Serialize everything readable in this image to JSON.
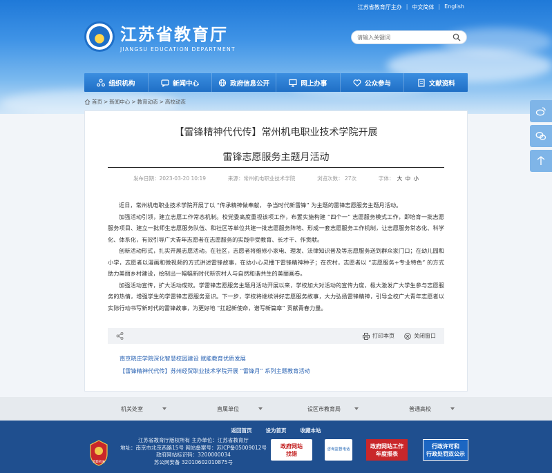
{
  "top_links": [
    "江苏省教育厅主办",
    "中文简体",
    "English"
  ],
  "logo": {
    "cn": "江苏省教育厅",
    "en": "JIANGSU EDUCATION DEPARTMENT"
  },
  "search": {
    "placeholder": "请输入关键词"
  },
  "nav": [
    {
      "label": "组织机构",
      "icon": "org-icon"
    },
    {
      "label": "新闻中心",
      "icon": "chat-icon"
    },
    {
      "label": "政府信息公开",
      "icon": "globe-icon"
    },
    {
      "label": "网上办事",
      "icon": "monitor-icon"
    },
    {
      "label": "公众参与",
      "icon": "heart-icon"
    },
    {
      "label": "文献资料",
      "icon": "book-icon"
    }
  ],
  "breadcrumb": [
    "首页",
    "新闻中心",
    "教育动态",
    "高校动态"
  ],
  "article": {
    "title_line1": "【雷锋精神代代传】常州机电职业技术学院开展",
    "title_line2": "雷锋志愿服务主题月活动",
    "meta": {
      "date": "发布日期：2023-03-20 10:19",
      "source": "来源：常州机电职业技术学院",
      "views": "浏览次数：  27次",
      "font_label": "字体：",
      "sizes": [
        "大",
        "中",
        "小"
      ]
    },
    "paragraphs": [
      "近日，常州机电职业技术学院开展了以 “传承精神做奉献， 争当时代新雷锋” 为主题的雷锋志愿服务主题月活动。",
      "加强活动引领，建立志愿工作常态机制。校党委高度重视该项工作，布置实施构建 “四个一” 志愿服务模式工作，即培育一批志愿服务项目、建立一批师生志愿服务队伍、和社区等单位共建一批志愿服务阵地、形成一套志愿服务工作机制，让志愿服务常态化、科学化、体系化，有效引导广大青年志愿者在志愿服务的实践中受教育、长才干、作贡献。",
      "创新活动形式，扎实开展志愿活动。在社区，志愿者将维修小家电、理发、法律知识普及等志愿服务送到群众家门口；在幼儿园和小学，志愿者以漫画和微视频的方式讲述雷锋故事，在幼小心灵播下雷锋精神种子；在农村，志愿者以 “志愿服务+专业特色” 的方式助力美丽乡村建设，绘制出一幅幅新时代新农村人与自然和谐共生的美丽画卷。",
      "加强活动宣传，扩大活动成效。学雷锋志愿服务主题月活动开展以来，学校加大对活动的宣传力度，极大激发广大学生参与志愿服务的热情，增强学生的学雷锋志愿服务意识。下一步，学校将继续讲好志愿服务故事，大力弘扬雷锋精神，引导全校广大青年志愿者以实际行动书写新时代的雷锋故事，为更好地 “扛起新使命，谱写新篇章” 贡献青春力量。"
    ],
    "print_label": "打印本页",
    "close_label": "关闭窗口"
  },
  "related": [
    "南京晓庄学院深化智慧校园建设 赋能教育优质发展",
    "【雷锋精神代代传】苏州经贸职业技术学院开展 “雷锋月” 系列主题教育活动"
  ],
  "footer_links": [
    "机关处室",
    "直属单位",
    "设区市教育局",
    "普通高校"
  ],
  "footer": {
    "nav": [
      "返回首页",
      "设为首页",
      "收藏本站"
    ],
    "info": [
      "江苏省教育厅版权所有  主办单位：江苏省教育厅",
      "地址：南京市北京西路15号  网站备案号：苏ICP备05009012号",
      "政府网站标识码：3200000034",
      "苏公网安备 32010602010875号"
    ],
    "badges": {
      "gov_error": [
        "政府网站",
        "找错"
      ],
      "complaint": "咨询监督电话",
      "annual": [
        "政府网站工作",
        "年度报表"
      ],
      "permit": [
        "行政许可和",
        "行政处罚双公示"
      ]
    },
    "party_badge": "党政机关"
  },
  "colors": {
    "nav_blue": "#1f6fc6",
    "footer_blue": "#1f4f8f",
    "link_blue": "#2a63b3"
  }
}
